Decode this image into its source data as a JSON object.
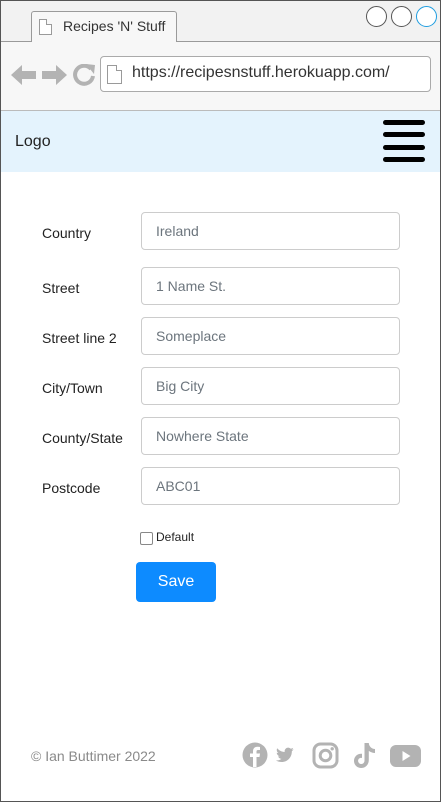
{
  "browser": {
    "tab_title": "Recipes 'N' Stuff",
    "url": "https://recipesnstuff.herokuapp.com/"
  },
  "header": {
    "logo": "Logo",
    "menu_icon": "hamburger-menu-icon"
  },
  "form": {
    "fields": [
      {
        "label": "Country",
        "value": "Ireland"
      },
      {
        "label": "Street",
        "value": "1 Name St."
      },
      {
        "label": "Street line 2",
        "value": "Someplace"
      },
      {
        "label": "City/Town",
        "value": "Big City"
      },
      {
        "label": "County/State",
        "value": "Nowhere State"
      },
      {
        "label": "Postcode",
        "value": "ABC01"
      }
    ],
    "default_label": "Default",
    "default_checked": false,
    "save_label": "Save"
  },
  "footer": {
    "copyright": "© Ian Buttimer 2022",
    "social_icons": [
      "facebook-icon",
      "twitter-icon",
      "instagram-icon",
      "tiktok-icon",
      "youtube-icon"
    ]
  },
  "colors": {
    "header_bg": "#e4f3fd",
    "primary": "#0d8bff",
    "social_grey": "#b3b3b3"
  }
}
